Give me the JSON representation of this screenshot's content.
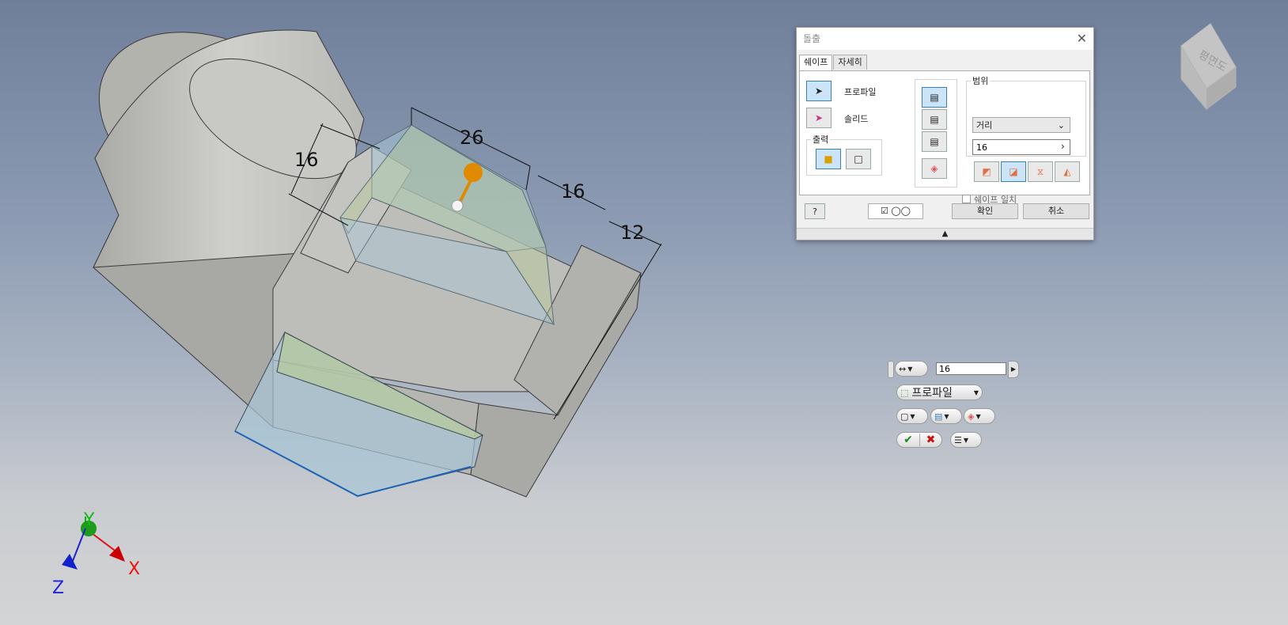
{
  "viewport": {
    "dimensions": [
      "16",
      "26",
      "16",
      "12"
    ],
    "axes": {
      "x": "X",
      "y": "Y",
      "z": "Z"
    },
    "view_cube_label": "평면도"
  },
  "dialog": {
    "title": "돌출",
    "close_icon": "close-icon",
    "tabs": [
      "쉐이프",
      "자세히"
    ],
    "profile_label": "프로파일",
    "solid_label": "솔리드",
    "output_group_label": "출력",
    "extents_group_label": "범위",
    "extents_type": "거리",
    "distance_value": "16",
    "match_shape_label": "쉐이프 일치",
    "ok_label": "확인",
    "cancel_label": "취소"
  },
  "mini_toolbar": {
    "distance_value": "16",
    "profile_label": "프로파일"
  },
  "colors": {
    "accent": "#3c7fb1",
    "preview_fill": "#a8c6d6",
    "preview_green": "#b8c99a",
    "manipulator": "#e08a00"
  }
}
